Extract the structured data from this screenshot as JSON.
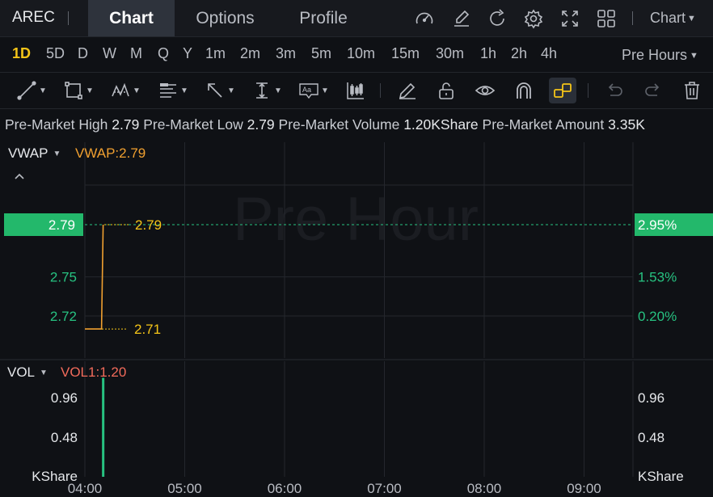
{
  "topbar": {
    "ticker": "AREC",
    "tabs": [
      {
        "label": "Chart",
        "active": true
      },
      {
        "label": "Options",
        "active": false
      },
      {
        "label": "Profile",
        "active": false
      }
    ],
    "icons": [
      "speedometer-icon",
      "edit-icon",
      "refresh-icon",
      "settings-gear-icon",
      "fullscreen-icon",
      "grid-layout-icon"
    ],
    "chart_menu_label": "Chart"
  },
  "periods": [
    "1D",
    "5D",
    "D",
    "W",
    "M",
    "Q",
    "Y",
    "1m",
    "2m",
    "3m",
    "5m",
    "10m",
    "15m",
    "30m",
    "1h",
    "2h",
    "4h"
  ],
  "active_period": "1D",
  "session_label": "Pre Hours",
  "drawing_tools": [
    "trend-line-icon",
    "rectangle-icon",
    "pattern-icon",
    "fibonacci-icon",
    "arrow-icon",
    "measure-icon",
    "text-annotation-icon",
    "candlestick-icon",
    "pencil-icon",
    "unlock-icon",
    "eye-icon",
    "magnet-icon",
    "link-icon",
    "undo-icon",
    "redo-icon",
    "trash-icon"
  ],
  "stats": {
    "high_label": "Pre-Market High",
    "high_value": "2.79",
    "low_label": "Pre-Market Low",
    "low_value": "2.79",
    "volume_label": "Pre-Market Volume",
    "volume_value": "1.20KShare",
    "amount_label": "Pre-Market Amount",
    "amount_value": "3.35K"
  },
  "indicators": {
    "price": {
      "name": "VWAP",
      "value_text": "VWAP:2.79"
    },
    "volume": {
      "name": "VOL",
      "value_text": "VOL1:1.20"
    }
  },
  "watermark": "Pre Hour",
  "colors": {
    "accent": "#f5c518",
    "up": "#27c281",
    "vwap": "#f0a030",
    "vol_label": "#f26b5b",
    "price_tag_bg": "#23b86b"
  },
  "chart_data": {
    "type": "line",
    "x_ticks": [
      "04:00",
      "05:00",
      "06:00",
      "07:00",
      "08:00",
      "09:00"
    ],
    "price_axis": {
      "left_ticks": [
        "2.79",
        "2.75",
        "2.72"
      ],
      "right_ticks": [
        "2.95%",
        "1.53%",
        "0.20%"
      ],
      "current_price": "2.79",
      "current_change": "2.95%"
    },
    "price_series": [
      {
        "time": "04:00",
        "value": 2.71
      },
      {
        "time": "04:10",
        "value": 2.71
      },
      {
        "time": "04:11",
        "value": 2.79
      }
    ],
    "annotations": [
      {
        "text": "2.79",
        "value": 2.79
      },
      {
        "text": "2.71",
        "value": 2.71
      }
    ],
    "volume_axis": {
      "ticks": [
        "0.96",
        "0.48"
      ],
      "unit": "KShare"
    },
    "volume_series": [
      {
        "time": "04:11",
        "value": 1.2
      }
    ],
    "grid": true
  }
}
